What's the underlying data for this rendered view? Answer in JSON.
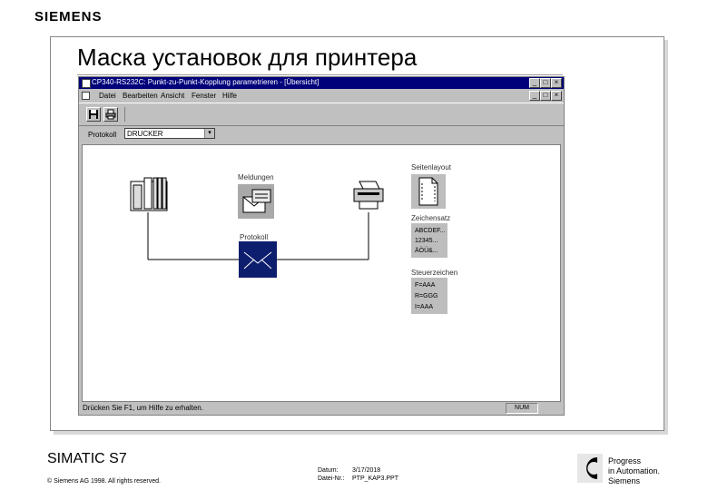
{
  "brand": "SIEMENS",
  "slide_title": "Маска установок для принтера",
  "window": {
    "title": "CP340-RS232C: Punkt-zu-Punkt-Kopplung parametrieren - [Übersicht]",
    "menu": [
      "Datei",
      "Bearbeiten",
      "Ansicht",
      "Fenster",
      "Hilfe"
    ],
    "titlebar_buttons": [
      "_",
      "□",
      "×"
    ],
    "mdi_buttons": [
      "_",
      "□",
      "×"
    ],
    "toolbar_icons": [
      "save-icon",
      "print-icon"
    ]
  },
  "protocol": {
    "label": "Protokoll",
    "value": "DRUCKER",
    "arrow": "▾"
  },
  "diagram": {
    "meldungen_label": "Meldungen",
    "protokoll_label": "Protokoll",
    "seitenlayout_label": "Seitenlayout",
    "zeichensatz_label": "Zeichensatz",
    "zeichensatz_lines": [
      "ABCDEF...",
      "12345...",
      "ÄÖÜ&..."
    ],
    "steuerzeichen_label": "Steuerzeichen",
    "steuerzeichen_lines": [
      "F=AAA",
      "R=GGG",
      "I=AAA"
    ]
  },
  "statusbar": {
    "text": "Drücken Sie F1, um Hilfe zu erhalten.",
    "num": "NUM"
  },
  "footer": {
    "title": "SIMATIC S7",
    "copyright": "© Siemens AG 1998. All rights reserved.",
    "datum_label": "Datum:",
    "datum_value": "3/17/2018",
    "datei_label": "Datei-Nr.:",
    "datei_value": "PTP_KAP3.PPT",
    "tagline": [
      "Progress",
      "in Automation.",
      "Siemens"
    ]
  }
}
